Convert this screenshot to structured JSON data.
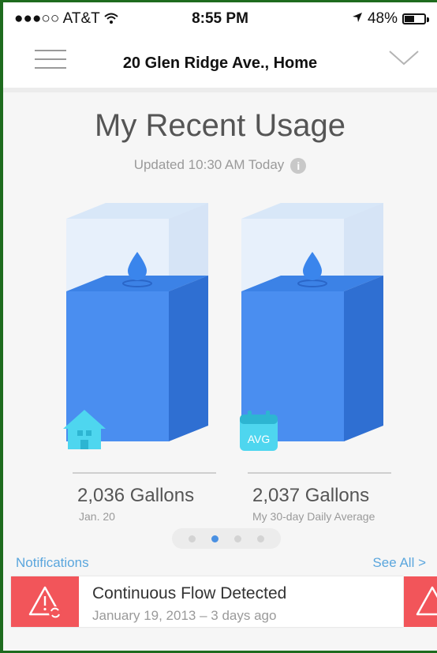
{
  "status_bar": {
    "carrier": "●●●○○ AT&T",
    "time": "8:55 PM",
    "battery": "48%",
    "icons": [
      "wifi-icon",
      "location-arrow-icon",
      "battery-icon"
    ]
  },
  "nav": {
    "title": "20 Glen Ridge Ave., Home",
    "icons": [
      "hamburger-menu-icon",
      "chevron-down-icon"
    ]
  },
  "usage": {
    "heading": "My Recent Usage",
    "updated": "Updated 10:30 AM Today",
    "tanks": [
      {
        "value": "2,036 Gallons",
        "label": "Jan. 20",
        "icon": "house-icon"
      },
      {
        "value": "2,037 Gallons",
        "label": "My 30-day Daily Average",
        "icon": "avg-calendar-icon",
        "icon_text": "AVG"
      }
    ],
    "pager": {
      "pages": 4,
      "active": 1
    }
  },
  "notifications": {
    "title": "Notifications",
    "see_all": "See All >",
    "items": [
      {
        "title": "Continuous Flow Detected",
        "date": "January 19, 2013 – 3 days ago",
        "icon": "warning-flow-icon"
      }
    ]
  },
  "colors": {
    "water_blue": "#4a8ef0",
    "accent_blue": "#5aa6dd",
    "alert_red": "#f2555a",
    "border_green": "#1e6b1e"
  }
}
